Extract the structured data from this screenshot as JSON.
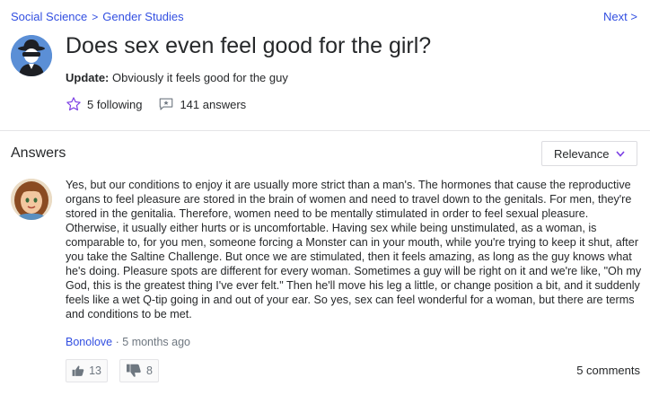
{
  "breadcrumb": {
    "category": "Social Science",
    "subcategory": "Gender Studies",
    "separator": ">"
  },
  "nav": {
    "next_label": "Next",
    "next_arrow": ">"
  },
  "question": {
    "title": "Does sex even feel good for the girl?",
    "update_label": "Update:",
    "update_text": "Obviously it feels good for the guy",
    "following_count": "5 following",
    "answers_count": "141 answers",
    "asker_avatar_icon": "anonymous-spy-avatar"
  },
  "answers_section": {
    "heading": "Answers",
    "sort_label": "Relevance"
  },
  "answer": {
    "body": "Yes, but our conditions to enjoy it are usually more strict than a man's. The hormones that cause the reproductive organs to feel pleasure are stored in the brain of women and need to travel down to the genitals. For men, they're stored in the genitalia. Therefore, women need to be mentally stimulated in order to feel sexual pleasure. Otherwise, it usually either hurts or is uncomfortable. Having sex while being unstimulated, as a woman, is comparable to, for you men, someone forcing a Monster can in your mouth, while you're trying to keep it shut, after you take the Saltine Challenge. But once we are stimulated, then it feels amazing, as long as the guy knows what he's doing. Pleasure spots are different for every woman. Sometimes a guy will be right on it and we're like, \"Oh my God, this is the greatest thing I've ever felt.\" Then he'll move his leg a little, or change position a bit, and it suddenly feels like a wet Q-tip going in and out of your ear. So yes, sex can feel wonderful for a woman, but there are terms and conditions to be met.",
    "author": "Bonolove",
    "meta_separator": "·",
    "time_ago": "5 months ago",
    "thumbs_up": "13",
    "thumbs_down": "8",
    "comments": "5 comments"
  },
  "colors": {
    "link": "#324fe1",
    "text": "#26282a",
    "muted": "#6e7780",
    "avatar_bg": "#5b8fd6",
    "star_outline": "#7b3fe4"
  }
}
